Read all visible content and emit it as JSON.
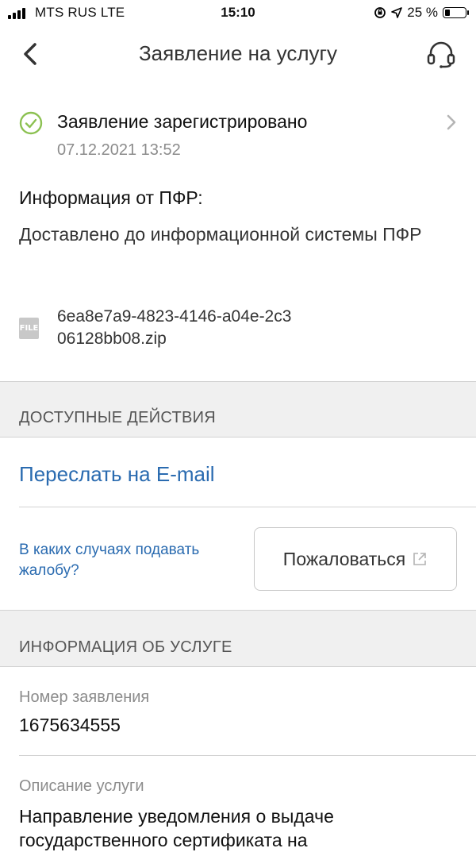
{
  "status_bar": {
    "carrier": "MTS RUS  LTE",
    "time": "15:10",
    "battery_text": "25 %",
    "battery_level": 0.25
  },
  "header": {
    "title": "Заявление на услугу",
    "back_icon": "chevron-left-icon",
    "support_icon": "headset-icon"
  },
  "application_status": {
    "title": "Заявление зарегистрировано",
    "date": "07.12.2021 13:52",
    "icon": "check-circle-icon",
    "color": "#8cc152"
  },
  "pfr_info": {
    "heading": "Информация от ПФР:",
    "text": "Доставлено до информационной системы ПФР"
  },
  "attachment": {
    "icon_label": "FILE",
    "file_name": "6ea8e7a9-4823-4146-a04e-2c306128bb08.zip"
  },
  "actions_section": {
    "heading": "ДОСТУПНЫЕ ДЕЙСТВИЯ",
    "email_link": "Переслать на E-mail",
    "complaint_info": "В каких случаях подавать жалобу?",
    "complain_button": "Пожаловаться"
  },
  "service_info_section": {
    "heading": "ИНФОРМАЦИЯ ОБ УСЛУГЕ",
    "number_label": "Номер заявления",
    "number_value": "1675634555",
    "description_label": "Описание услуги",
    "description_value": "Направление уведомления о выдаче государственного сертификата на"
  },
  "colors": {
    "link": "#2a6bb0",
    "section_bg": "#f0f0f0",
    "divider": "#d2d2d2",
    "muted_text": "#8c8c8c"
  }
}
